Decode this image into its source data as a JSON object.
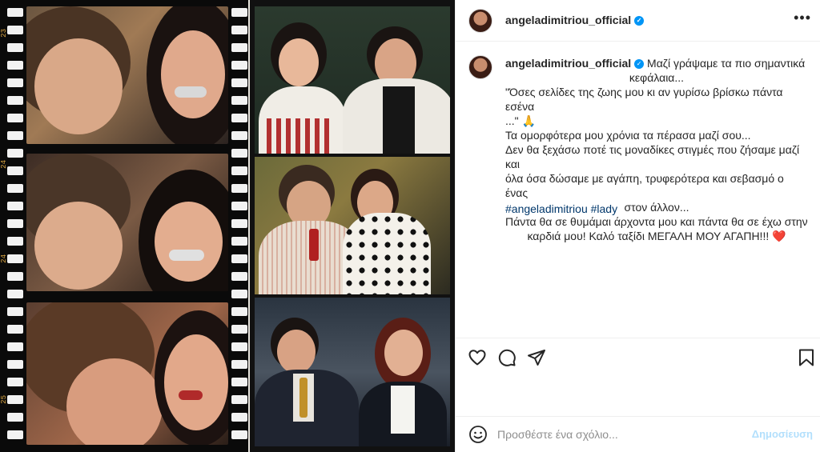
{
  "post": {
    "username": "angeladimitriou_official",
    "more_icon": "more-options-icon",
    "verified_icon": "verified-badge-icon"
  },
  "caption": {
    "username": "angeladimitriou_official",
    "lines": [
      "Μαζί γράψαμε τα πιο σημαντικά",
      "κεφάλαια...",
      "\"Όσες σελίδες της ζωης μου κι αν γυρίσω βρίσκω πάντα εσένα",
      "...\" 🙏",
      "Τα ομορφότερα μου χρόνια τα πέρασα μαζί σου...",
      "Δεν θα ξεχάσω ποτέ τις μοναδίκες στιγμές που ζήσαμε μαζί και",
      "όλα όσα δώσαμε με αγάπη, τρυφερότερα και σεβασμό ο ένας",
      "στον άλλον...",
      "Πάντα θα σε θυμάμαι άρχοντα μου και πάντα θα σε έχω στην",
      "καρδιά μου! Καλό ταξίδι ΜΕΓΑΛΗ ΜΟΥ ΑΓΑΠΗ!!! ❤️"
    ],
    "hashtags": [
      "#angeladimitriou",
      "#lady"
    ]
  },
  "actions": {
    "like_icon": "heart-icon",
    "comment_icon": "comment-icon",
    "share_icon": "send-icon",
    "save_icon": "bookmark-icon"
  },
  "comment_bar": {
    "emoji_icon": "emoji-icon",
    "placeholder": "Προσθέστε ένα σχόλιο...",
    "post_label": "Δημοσίευση"
  },
  "filmstrip": {
    "frame_numbers": [
      "23",
      "23",
      "24",
      "24",
      "25",
      "25"
    ]
  },
  "colors": {
    "link": "#00376b",
    "verified": "#0095f6",
    "post_button_disabled": "#b2dffc",
    "border": "#efefef"
  }
}
